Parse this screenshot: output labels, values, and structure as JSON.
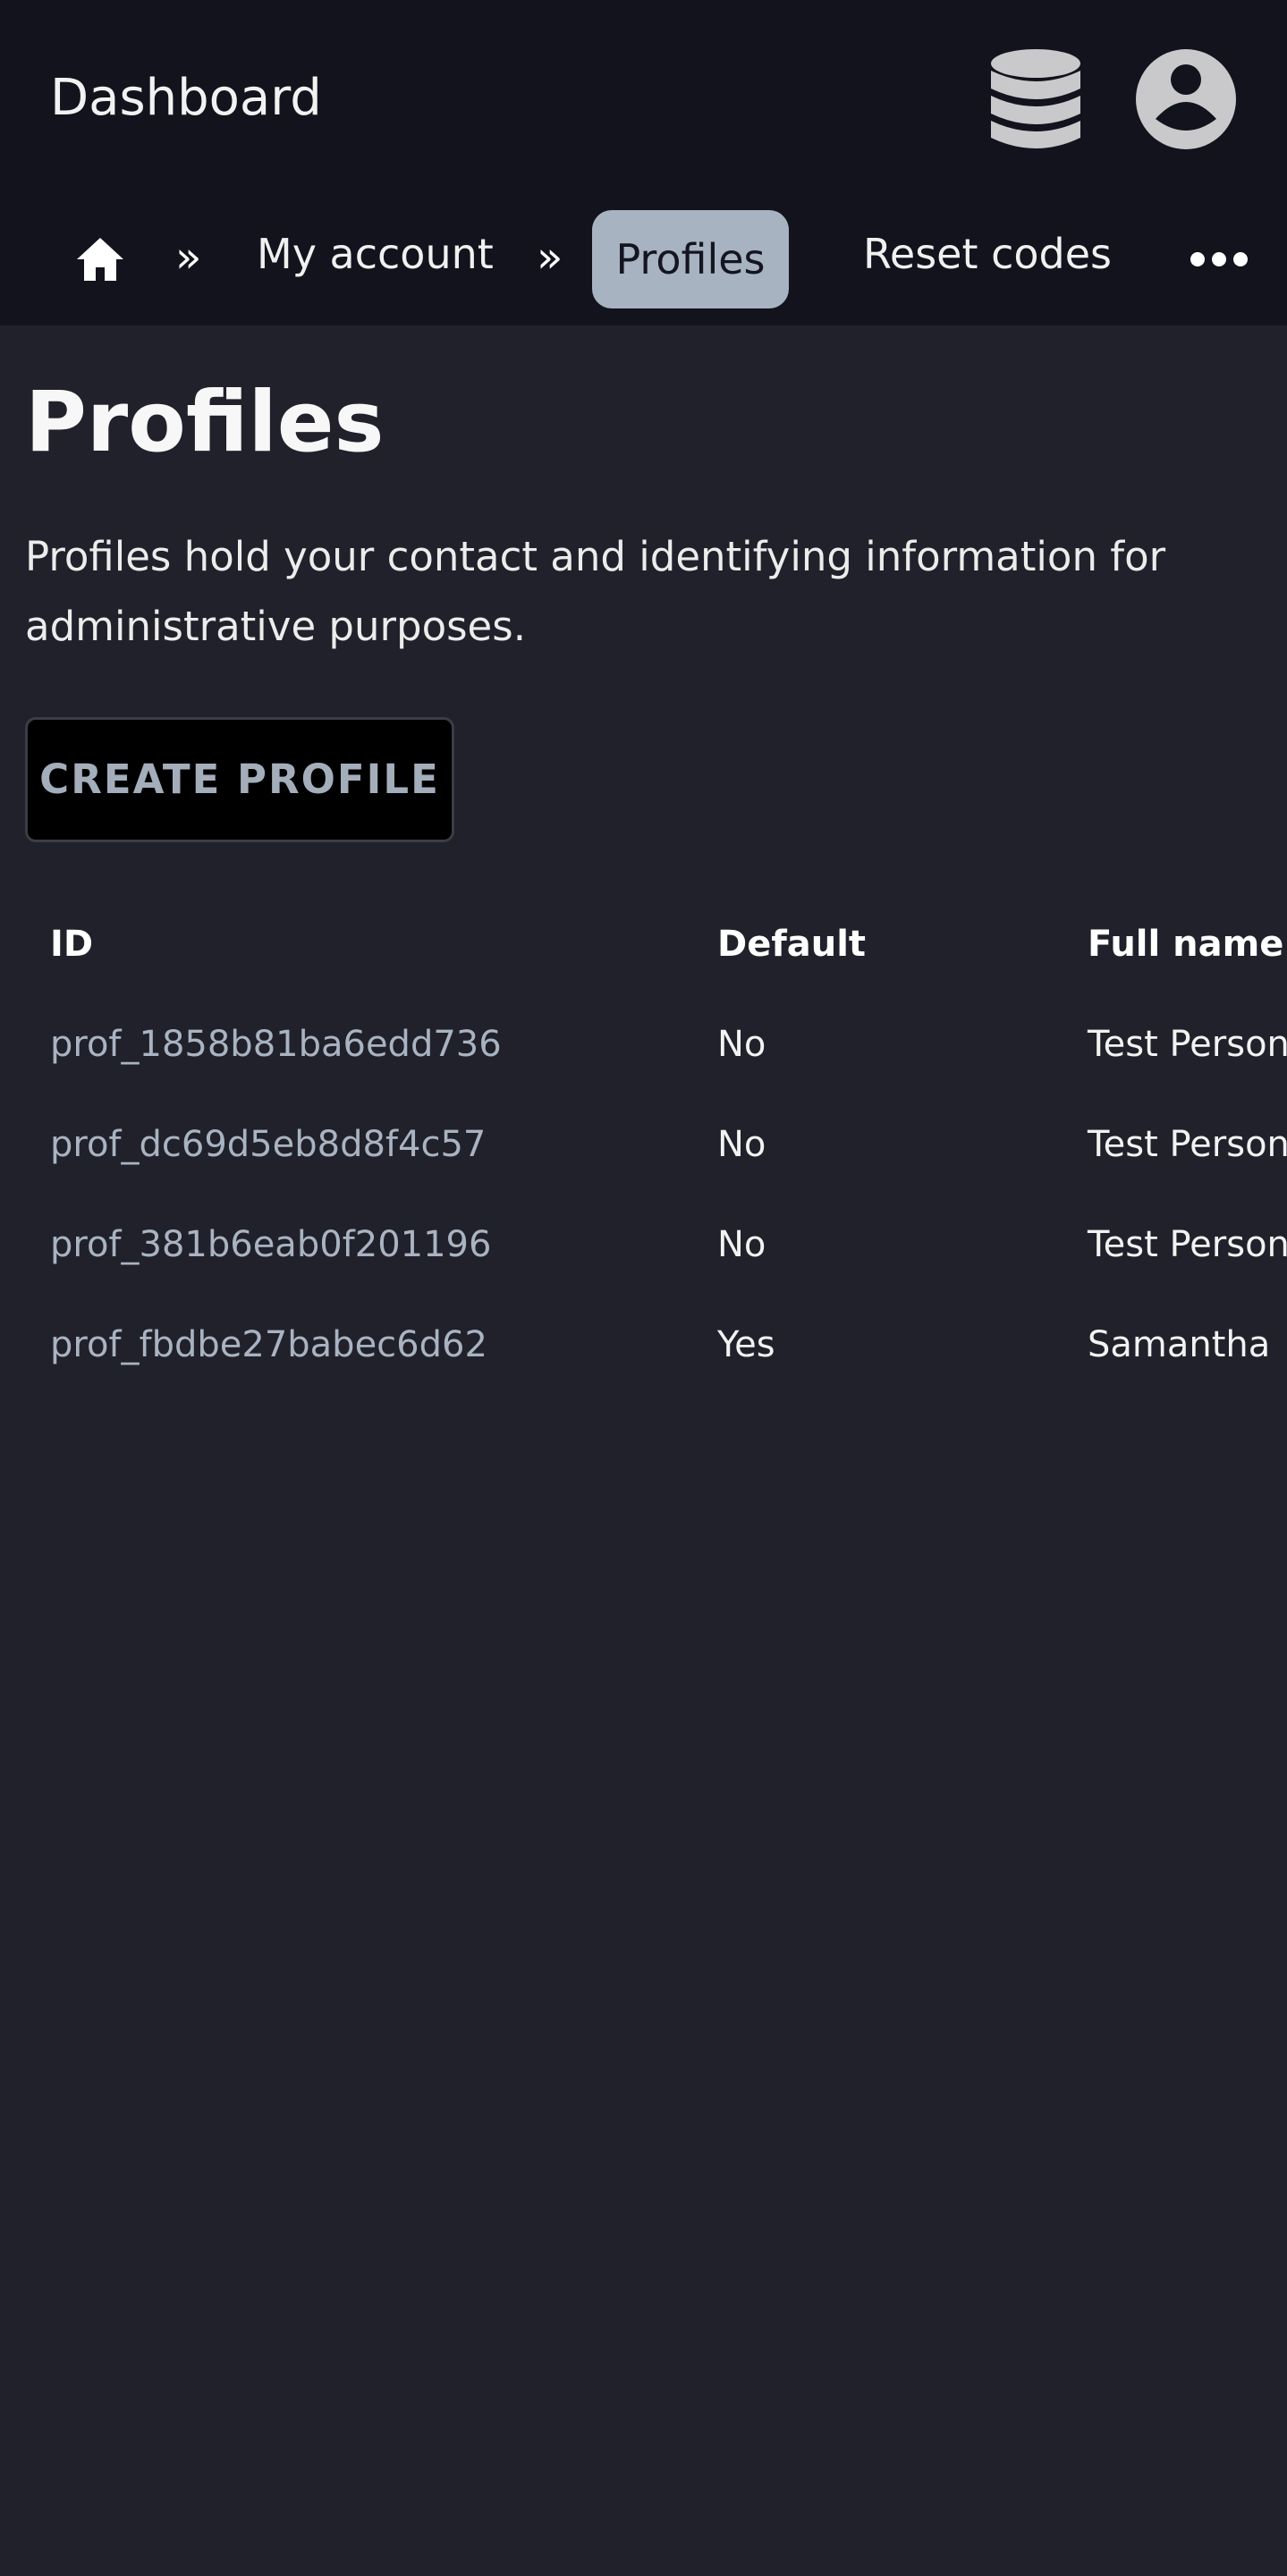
{
  "header": {
    "app_title": "Dashboard",
    "icons": [
      "database-icon",
      "user-account-icon"
    ]
  },
  "nav": {
    "home_icon": "home-icon",
    "separator": "»",
    "items": [
      {
        "label": "My account",
        "active": false
      },
      {
        "label": "Profiles",
        "active": true
      },
      {
        "label": "Reset codes",
        "active": false
      }
    ],
    "more_icon": "more-horizontal-icon"
  },
  "page": {
    "title": "Profiles",
    "description": "Profiles hold your contact and identifying information for administrative purposes.",
    "create_button_label": "CREATE PROFILE"
  },
  "table": {
    "columns": [
      "ID",
      "Default",
      "Full name"
    ],
    "rows": [
      {
        "id": "prof_1858b81ba6edd736",
        "default": "No",
        "full_name": "Test Person"
      },
      {
        "id": "prof_dc69d5eb8d8f4c57",
        "default": "No",
        "full_name": "Test Person"
      },
      {
        "id": "prof_381b6eab0f201196",
        "default": "No",
        "full_name": "Test Person"
      },
      {
        "id": "prof_fbdbe27babec6d62",
        "default": "Yes",
        "full_name": "Samantha"
      }
    ]
  },
  "colors": {
    "page_background": "#20212a",
    "header_background": "#12131c",
    "active_tab": "#a7b3c1",
    "link_text": "#a9b3c2",
    "button_background": "#000000"
  }
}
